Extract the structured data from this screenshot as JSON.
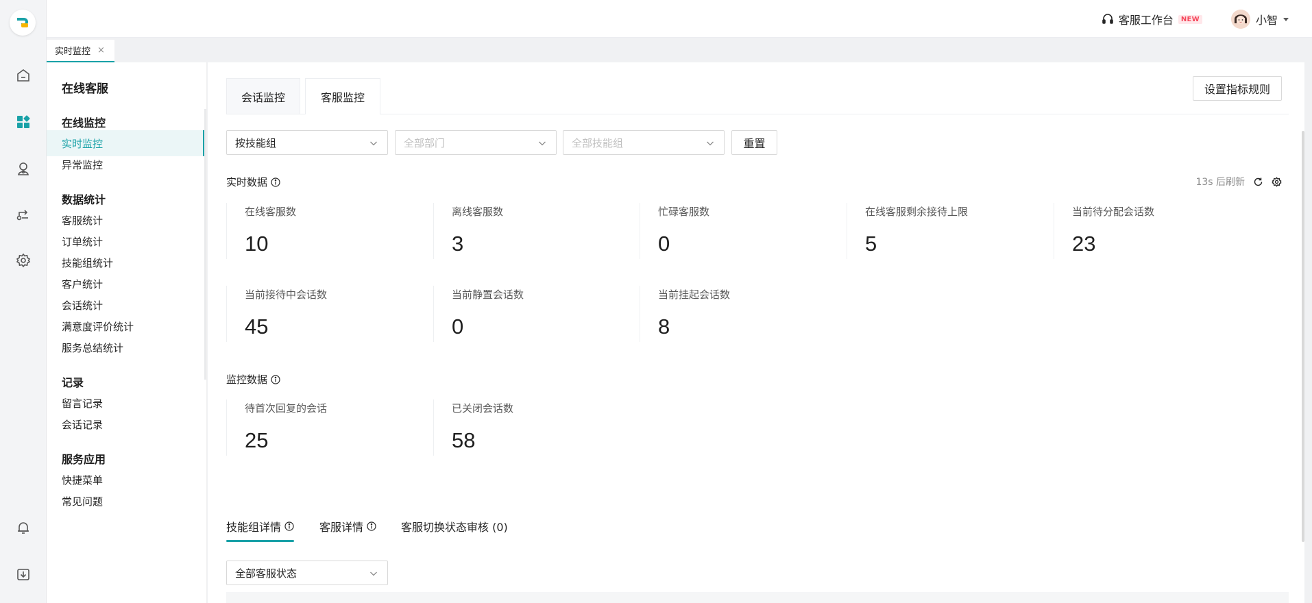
{
  "header": {
    "workbench_label": "客服工作台",
    "new_badge": "NEW",
    "user_name": "小智"
  },
  "page_tab": {
    "label": "实时监控",
    "close": "×"
  },
  "sidenav": {
    "module_title": "在线客服",
    "groups": [
      {
        "title": "在线监控",
        "items": [
          "实时监控",
          "异常监控"
        ]
      },
      {
        "title": "数据统计",
        "items": [
          "客服统计",
          "订单统计",
          "技能组统计",
          "客户统计",
          "会话统计",
          "满意度评价统计",
          "服务总结统计"
        ]
      },
      {
        "title": "记录",
        "items": [
          "留言记录",
          "会话记录"
        ]
      },
      {
        "title": "服务应用",
        "items": [
          "快捷菜单",
          "常见问题"
        ]
      }
    ],
    "active_item": "实时监控"
  },
  "tabs": [
    "会话监控",
    "客服监控"
  ],
  "active_tab": "客服监控",
  "settings_button": "设置指标规则",
  "filters": {
    "group_by": "按技能组",
    "department_placeholder": "全部部门",
    "skill_group_placeholder": "全部技能组",
    "reset": "重置"
  },
  "realtime": {
    "title": "实时数据",
    "refresh_text": "13s 后刷新",
    "metrics": [
      {
        "label": "在线客服数",
        "value": "10"
      },
      {
        "label": "离线客服数",
        "value": "3"
      },
      {
        "label": "忙碌客服数",
        "value": "0"
      },
      {
        "label": "在线客服剩余接待上限",
        "value": "5"
      },
      {
        "label": "当前待分配会话数",
        "value": "23"
      },
      {
        "label": "当前接待中会话数",
        "value": "45"
      },
      {
        "label": "当前静置会话数",
        "value": "0"
      },
      {
        "label": "当前挂起会话数",
        "value": "8"
      }
    ]
  },
  "monitor": {
    "title": "监控数据",
    "metrics": [
      {
        "label": "待首次回复的会话",
        "value": "25"
      },
      {
        "label": "已关闭会话数",
        "value": "58"
      }
    ]
  },
  "detail_tabs": [
    "技能组详情",
    "客服详情",
    "客服切换状态审核 (0)"
  ],
  "active_detail_tab": "技能组详情",
  "status_filter": "全部客服状态",
  "colors": {
    "accent": "#19a1a7",
    "new_badge": "#f5465a"
  }
}
